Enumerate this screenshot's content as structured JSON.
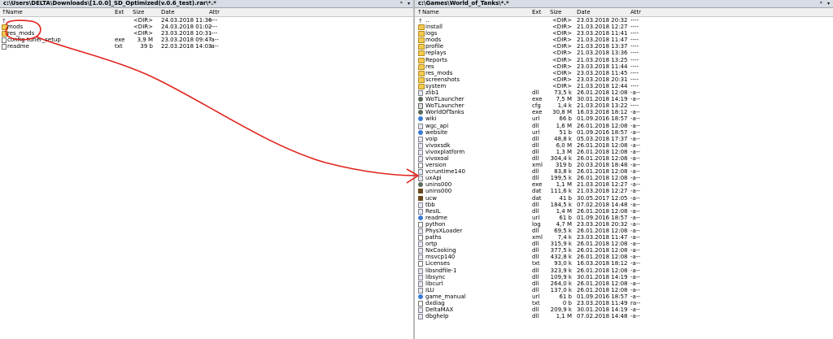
{
  "left_panel": {
    "path": "c:\\Users\\DELTA\\Downloads\\[1.0.0]_SD_Optimized(v.0.6_test).rar\\*.*",
    "header_buttons": [
      "*",
      "▾"
    ],
    "columns": {
      "name": "Name",
      "ext": "Ext",
      "size": "Size",
      "date": "Date",
      "attr": "Attr"
    },
    "rows": [
      {
        "icon": "up",
        "name": "..",
        "ext": "",
        "size": "<DIR>",
        "date": "24.03.2018 11:36",
        "attr": "----"
      },
      {
        "icon": "folder",
        "name": "mods",
        "ext": "",
        "size": "<DIR>",
        "date": "24.03.2018 01:02",
        "attr": "----"
      },
      {
        "icon": "folder",
        "name": "res_mods",
        "ext": "",
        "size": "<DIR>",
        "date": "23.03.2018 10:31",
        "attr": "----"
      },
      {
        "icon": "file",
        "name": "config-tuner_setup",
        "ext": "exe",
        "size": "3,9 M",
        "date": "23.03.2018 09:47",
        "attr": "-a--"
      },
      {
        "icon": "file",
        "name": "readme",
        "ext": "txt",
        "size": "39 b",
        "date": "22.03.2018 14:03",
        "attr": "-a--"
      }
    ]
  },
  "right_panel": {
    "path": "c:\\Games\\World_of_Tanks\\*.*",
    "header_buttons": [
      "*",
      "▾"
    ],
    "columns": {
      "name": "Name",
      "ext": "Ext",
      "size": "Size",
      "date": "Date",
      "attr": "Attr"
    },
    "rows": [
      {
        "icon": "up",
        "name": "..",
        "ext": "",
        "size": "<DIR>",
        "date": "23.03.2018 20:32",
        "attr": "----"
      },
      {
        "icon": "folder",
        "name": "install",
        "ext": "",
        "size": "<DIR>",
        "date": "21.03.2018 12:27",
        "attr": "----"
      },
      {
        "icon": "folder",
        "name": "logs",
        "ext": "",
        "size": "<DIR>",
        "date": "23.03.2018 11:41",
        "attr": "----"
      },
      {
        "icon": "folder",
        "name": "mods",
        "ext": "",
        "size": "<DIR>",
        "date": "21.03.2018 11:47",
        "attr": "----"
      },
      {
        "icon": "folder",
        "name": "profile",
        "ext": "",
        "size": "<DIR>",
        "date": "21.03.2018 13:37",
        "attr": "----"
      },
      {
        "icon": "folder",
        "name": "replays",
        "ext": "",
        "size": "<DIR>",
        "date": "21.03.2018 13:36",
        "attr": "----"
      },
      {
        "icon": "folder",
        "name": "Reports",
        "ext": "",
        "size": "<DIR>",
        "date": "21.03.2018 13:25",
        "attr": "----"
      },
      {
        "icon": "folder",
        "name": "res",
        "ext": "",
        "size": "<DIR>",
        "date": "23.03.2018 11:44",
        "attr": "----"
      },
      {
        "icon": "folder",
        "name": "res_mods",
        "ext": "",
        "size": "<DIR>",
        "date": "23.03.2018 11:45",
        "attr": "----"
      },
      {
        "icon": "folder",
        "name": "screenshots",
        "ext": "",
        "size": "<DIR>",
        "date": "23.03.2018 20:31",
        "attr": "----"
      },
      {
        "icon": "folder",
        "name": "system",
        "ext": "",
        "size": "<DIR>",
        "date": "21.03.2018 12:44",
        "attr": "----"
      },
      {
        "icon": "dll",
        "name": "zlib1",
        "ext": "dll",
        "size": "73,5 k",
        "date": "26.01.2018 12:08",
        "attr": "-a--"
      },
      {
        "icon": "exe",
        "name": "WoTLauncher",
        "ext": "exe",
        "size": "7,5 M",
        "date": "30.01.2018 14:19",
        "attr": "-a--"
      },
      {
        "icon": "cfg",
        "name": "WoTLauncher",
        "ext": "cfg",
        "size": "1,4 k",
        "date": "21.03.2018 13:22",
        "attr": "----"
      },
      {
        "icon": "exe",
        "name": "WorldOfTanks",
        "ext": "exe",
        "size": "30,8 M",
        "date": "16.03.2018 18:12",
        "attr": "-a--"
      },
      {
        "icon": "link",
        "name": "wiki",
        "ext": "url",
        "size": "66 b",
        "date": "01.09.2016 18:57",
        "attr": "-a--"
      },
      {
        "icon": "dll",
        "name": "wgc_api",
        "ext": "dll",
        "size": "1,6 M",
        "date": "26.01.2018 12:08",
        "attr": "-a--"
      },
      {
        "icon": "link",
        "name": "website",
        "ext": "url",
        "size": "51 b",
        "date": "01.09.2016 18:57",
        "attr": "-a--"
      },
      {
        "icon": "dll",
        "name": "voip",
        "ext": "dll",
        "size": "48,8 k",
        "date": "05.03.2018 17:37",
        "attr": "-a--"
      },
      {
        "icon": "dll",
        "name": "vivoxsdk",
        "ext": "dll",
        "size": "6,0 M",
        "date": "26.01.2018 12:08",
        "attr": "-a--"
      },
      {
        "icon": "dll",
        "name": "vivoxplatform",
        "ext": "dll",
        "size": "1,3 M",
        "date": "26.01.2018 12:08",
        "attr": "-a--"
      },
      {
        "icon": "dll",
        "name": "vivoxoal",
        "ext": "dll",
        "size": "304,4 k",
        "date": "26.01.2018 12:08",
        "attr": "-a--"
      },
      {
        "icon": "file",
        "name": "version",
        "ext": "xml",
        "size": "319 b",
        "date": "20.03.2018 18:48",
        "attr": "-a--"
      },
      {
        "icon": "dll",
        "name": "vcruntime140",
        "ext": "dll",
        "size": "83,8 k",
        "date": "26.01.2018 12:08",
        "attr": "-a--"
      },
      {
        "icon": "dll",
        "name": "uxApi",
        "ext": "dll",
        "size": "199,5 k",
        "date": "26.01.2018 12:08",
        "attr": "-a--"
      },
      {
        "icon": "exe",
        "name": "unins000",
        "ext": "exe",
        "size": "1,1 M",
        "date": "21.03.2018 12:27",
        "attr": "-a--"
      },
      {
        "icon": "app",
        "name": "unins000",
        "ext": "dat",
        "size": "111,6 k",
        "date": "21.03.2018 12:27",
        "attr": "-a--"
      },
      {
        "icon": "app",
        "name": "ucw",
        "ext": "dat",
        "size": "41 b",
        "date": "30.05.2017 12:05",
        "attr": "-a--"
      },
      {
        "icon": "dll",
        "name": "tbb",
        "ext": "dll",
        "size": "184,5 k",
        "date": "07.02.2018 14:48",
        "attr": "-a--"
      },
      {
        "icon": "dll",
        "name": "ResIL",
        "ext": "dll",
        "size": "1,4 M",
        "date": "26.01.2018 12:08",
        "attr": "-a--"
      },
      {
        "icon": "link",
        "name": "readme",
        "ext": "url",
        "size": "61 b",
        "date": "01.09.2016 18:57",
        "attr": "-a--"
      },
      {
        "icon": "file",
        "name": "python",
        "ext": "log",
        "size": "4,7 M",
        "date": "23.03.2018 20:32",
        "attr": "-a--"
      },
      {
        "icon": "dll",
        "name": "PhysXLoader",
        "ext": "dll",
        "size": "69,5 k",
        "date": "26.01.2018 12:08",
        "attr": "-a--"
      },
      {
        "icon": "file",
        "name": "paths",
        "ext": "xml",
        "size": "7,4 k",
        "date": "23.03.2018 11:47",
        "attr": "-a--"
      },
      {
        "icon": "dll",
        "name": "ortp",
        "ext": "dll",
        "size": "315,9 k",
        "date": "26.01.2018 12:08",
        "attr": "-a--"
      },
      {
        "icon": "dll",
        "name": "NxCooking",
        "ext": "dll",
        "size": "377,5 k",
        "date": "26.01.2018 12:08",
        "attr": "-a--"
      },
      {
        "icon": "dll",
        "name": "msvcp140",
        "ext": "dll",
        "size": "432,8 k",
        "date": "26.01.2018 12:08",
        "attr": "-a--"
      },
      {
        "icon": "file",
        "name": "Licenses",
        "ext": "txt",
        "size": "93,0 k",
        "date": "16.03.2018 18:12",
        "attr": "-a--"
      },
      {
        "icon": "dll",
        "name": "libsndfile-1",
        "ext": "dll",
        "size": "323,9 k",
        "date": "26.01.2018 12:08",
        "attr": "-a--"
      },
      {
        "icon": "dll",
        "name": "libsync",
        "ext": "dll",
        "size": "109,9 k",
        "date": "30.01.2018 14:19",
        "attr": "-a--"
      },
      {
        "icon": "dll",
        "name": "libcurl",
        "ext": "dll",
        "size": "264,0 k",
        "date": "26.01.2018 12:08",
        "attr": "-a--"
      },
      {
        "icon": "dll",
        "name": "ILU",
        "ext": "dll",
        "size": "137,0 k",
        "date": "26.01.2018 12:08",
        "attr": "-a--"
      },
      {
        "icon": "link",
        "name": "game_manual",
        "ext": "url",
        "size": "61 b",
        "date": "01.09.2016 18:57",
        "attr": "-a--"
      },
      {
        "icon": "file",
        "name": "dxdiag",
        "ext": "txt",
        "size": "0 b",
        "date": "23.03.2018 11:49",
        "attr": "ra--"
      },
      {
        "icon": "dll",
        "name": "DeltaMAX",
        "ext": "dll",
        "size": "209,9 k",
        "date": "30.01.2018 14:19",
        "attr": "-a--"
      },
      {
        "icon": "dll",
        "name": "dbghelp",
        "ext": "dll",
        "size": "1,1 M",
        "date": "07.02.2018 14:48",
        "attr": "-a--"
      }
    ]
  },
  "annotation": {
    "color": "#e0231c"
  }
}
